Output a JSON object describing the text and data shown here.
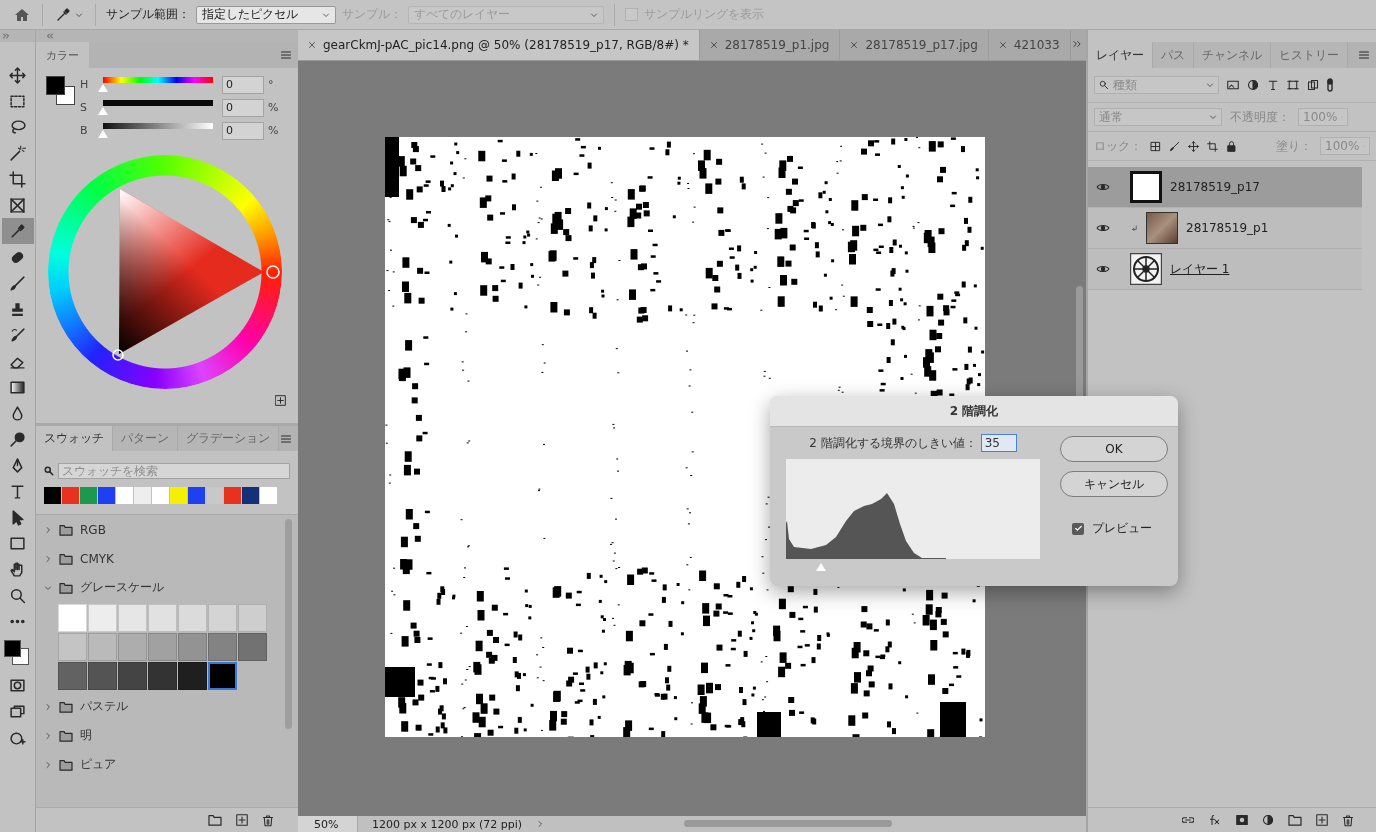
{
  "options_bar": {
    "sample_size": {
      "label": "サンプル範囲：",
      "value": "指定したピクセル",
      "disabled": false
    },
    "sample": {
      "label": "サンプル：",
      "value": "すべてのレイヤー",
      "disabled": true
    },
    "sample_ring": {
      "label": "サンプルリングを表示",
      "checked": false,
      "disabled": true
    }
  },
  "tools": [
    {
      "kind": "move",
      "selected": false
    },
    {
      "kind": "marquee",
      "selected": false
    },
    {
      "kind": "lasso",
      "selected": false
    },
    {
      "kind": "wand",
      "selected": false
    },
    {
      "kind": "crop",
      "selected": false
    },
    {
      "kind": "frame",
      "selected": false
    },
    {
      "kind": "eyedropper",
      "selected": true
    },
    {
      "kind": "healing",
      "selected": false
    },
    {
      "kind": "brush",
      "selected": false
    },
    {
      "kind": "stamp",
      "selected": false
    },
    {
      "kind": "history",
      "selected": false
    },
    {
      "kind": "eraser",
      "selected": false
    },
    {
      "kind": "gradient",
      "selected": false
    },
    {
      "kind": "blur",
      "selected": false
    },
    {
      "kind": "dodge",
      "selected": false
    },
    {
      "kind": "pen",
      "selected": false
    },
    {
      "kind": "type",
      "selected": false
    },
    {
      "kind": "select",
      "selected": false
    },
    {
      "kind": "rectangle",
      "selected": false
    },
    {
      "kind": "hand",
      "selected": false
    },
    {
      "kind": "zoom",
      "selected": false
    },
    {
      "kind": "more",
      "selected": false
    }
  ],
  "color_panel": {
    "title": "カラー",
    "sliders": [
      {
        "kind": "hue",
        "label": "H",
        "value": "0",
        "unit": "°",
        "level": 0
      },
      {
        "kind": "saturation",
        "label": "S",
        "value": "0",
        "unit": "%",
        "level": 0
      },
      {
        "kind": "brightness",
        "label": "B",
        "value": "0",
        "unit": "%",
        "level": 0
      }
    ]
  },
  "swatches_panel": {
    "tabs": [
      {
        "label": "スウォッチ",
        "selected": true
      },
      {
        "label": "パターン",
        "selected": false
      },
      {
        "label": "グラデーション",
        "selected": false
      }
    ],
    "search": {
      "placeholder": "スウォッチを検索"
    },
    "recent": [
      {
        "color": "#000000"
      },
      {
        "color": "#e8321e"
      },
      {
        "color": "#1a9a50"
      },
      {
        "color": "#1f3ff0"
      },
      {
        "color": "#ffffff"
      },
      {
        "color": "#eeeeee"
      },
      {
        "color": "#ffffff"
      },
      {
        "color": "#f5f000"
      },
      {
        "color": "#1e40f0"
      },
      {
        "color": "#c8c8c8"
      },
      {
        "color": "#e8321e"
      },
      {
        "color": "#15307a"
      },
      {
        "color": "#ffffff"
      }
    ],
    "groups": [
      {
        "name": "RGB",
        "expanded": false
      },
      {
        "name": "CMYK",
        "expanded": false
      },
      {
        "name": "グレースケール",
        "expanded": true,
        "swatches": [
          {
            "color": "#ffffff",
            "selected": false
          },
          {
            "color": "#ededed",
            "selected": false
          },
          {
            "color": "#e6e6e6",
            "selected": false
          },
          {
            "color": "#e1e1e1",
            "selected": false
          },
          {
            "color": "#dbdbdb",
            "selected": false
          },
          {
            "color": "#d4d4d4",
            "selected": false
          },
          {
            "color": "#cecece",
            "selected": false
          },
          {
            "color": "#c4c4c4",
            "selected": false
          },
          {
            "color": "#bababa",
            "selected": false
          },
          {
            "color": "#adadad",
            "selected": false
          },
          {
            "color": "#a1a1a1",
            "selected": false
          },
          {
            "color": "#939393",
            "selected": false
          },
          {
            "color": "#838383",
            "selected": false
          },
          {
            "color": "#727272",
            "selected": false
          },
          {
            "color": "#626262",
            "selected": false
          },
          {
            "color": "#545454",
            "selected": false
          },
          {
            "color": "#444444",
            "selected": false
          },
          {
            "color": "#333333",
            "selected": false
          },
          {
            "color": "#1f1f1f",
            "selected": false
          },
          {
            "color": "#000000",
            "selected": true
          }
        ]
      },
      {
        "name": "パステル",
        "expanded": false
      },
      {
        "name": "明",
        "expanded": false
      },
      {
        "name": "ピュア",
        "expanded": false
      }
    ]
  },
  "document_tabs": [
    {
      "label": "gearCkmJ-pAC_pic14.png @ 50% (28178519_p17, RGB/8#) *",
      "selected": true
    },
    {
      "label": "28178519_p1.jpg",
      "selected": false
    },
    {
      "label": "28178519_p17.jpg",
      "selected": false
    },
    {
      "label": "421033",
      "selected": false
    }
  ],
  "status_bar": {
    "zoom": "50%",
    "info": "1200 px x 1200 px (72 ppi)"
  },
  "layers_panel": {
    "tabs": [
      {
        "label": "レイヤー",
        "selected": true
      },
      {
        "label": "パス",
        "selected": false
      },
      {
        "label": "チャンネル",
        "selected": false
      },
      {
        "label": "ヒストリー",
        "selected": false
      }
    ],
    "filter": "種類",
    "blend_mode": "通常",
    "opacity_label": "不透明度：",
    "opacity": "100%",
    "lock_label": "ロック：",
    "fill_label": "塗り：",
    "fill": "100%",
    "layers": [
      {
        "name": "28178519_p17",
        "kind": "mask",
        "selected": true,
        "visible": true,
        "clipped": false,
        "underlined": false
      },
      {
        "name": "28178519_p1",
        "kind": "photo",
        "selected": false,
        "visible": true,
        "clipped": true,
        "underlined": false
      },
      {
        "name": "レイヤー 1",
        "kind": "gear",
        "selected": false,
        "visible": true,
        "clipped": false,
        "underlined": true
      }
    ]
  },
  "threshold_dialog": {
    "title": "2 階調化",
    "threshold_label": "2 階調化する境界のしきい値：",
    "threshold": "35",
    "level": 0.137,
    "buttons": [
      "OK",
      "キャンセル"
    ],
    "preview": {
      "label": "プレビュー",
      "checked": true
    }
  }
}
